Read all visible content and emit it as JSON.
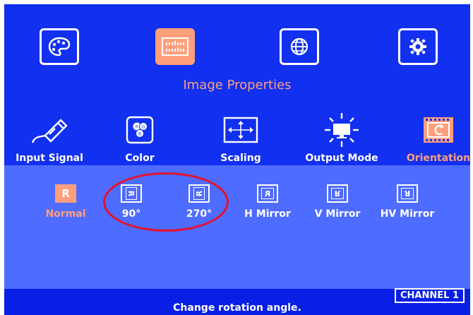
{
  "colors": {
    "screen_bg": "#1230f0",
    "options_bg": "#4e6cff",
    "accent": "#ff9f7c",
    "annotation": "#e8102a"
  },
  "top_menu": {
    "items": [
      {
        "icon": "palette-icon",
        "active": false
      },
      {
        "icon": "sliders-icon",
        "active": true
      },
      {
        "icon": "globe-icon",
        "active": false
      },
      {
        "icon": "gear-icon",
        "active": false
      }
    ],
    "title": "Image Properties"
  },
  "categories": [
    {
      "label": "Input Signal",
      "icon": "usb-cable-icon",
      "active": false
    },
    {
      "label": "Color",
      "icon": "rgb-circles-icon",
      "active": false
    },
    {
      "label": "Scaling",
      "icon": "arrows-expand-icon",
      "active": false
    },
    {
      "label": "Output Mode",
      "icon": "monitor-sun-icon",
      "active": false
    },
    {
      "label": "Orientation",
      "icon": "film-rotate-icon",
      "active": true
    }
  ],
  "options": [
    {
      "label": "Normal",
      "glyph": "R",
      "selected": true
    },
    {
      "label": "90°",
      "glyph": "R",
      "selected": false
    },
    {
      "label": "270°",
      "glyph": "R",
      "selected": false
    },
    {
      "label": "H Mirror",
      "glyph": "R",
      "selected": false
    },
    {
      "label": "V Mirror",
      "glyph": "R",
      "selected": false
    },
    {
      "label": "HV Mirror",
      "glyph": "R",
      "selected": false
    }
  ],
  "status": {
    "help_text": "Change rotation angle.",
    "channel": "CHANNEL 1"
  }
}
